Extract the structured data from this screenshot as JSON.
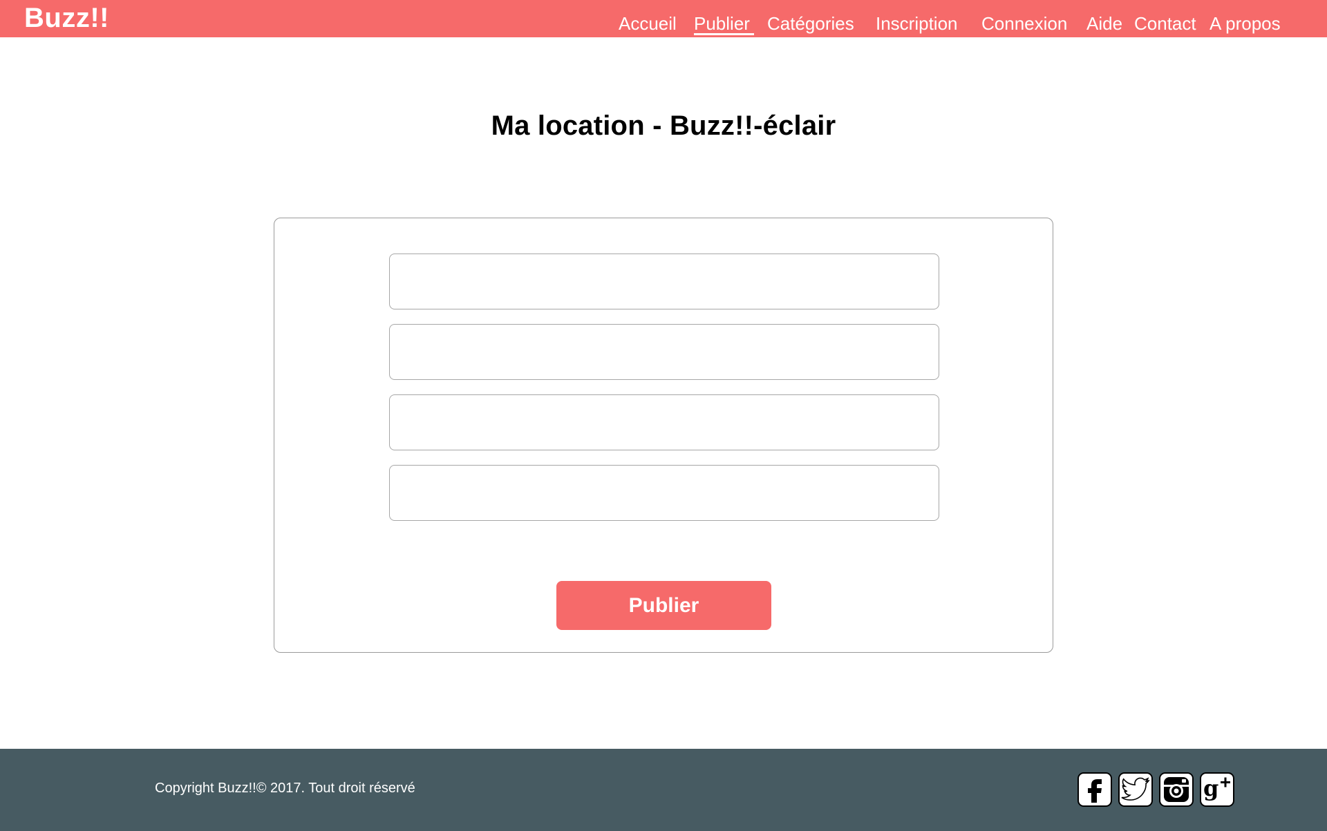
{
  "header": {
    "brand": "Buzz!!",
    "nav": [
      {
        "label": "Accueil",
        "active": false
      },
      {
        "label": "Publier",
        "active": true
      },
      {
        "label": "Catégories",
        "active": false
      },
      {
        "label": "Inscription",
        "active": false
      },
      {
        "label": "Connexion",
        "active": false
      },
      {
        "label": "Aide",
        "active": false
      },
      {
        "label": "Contact",
        "active": false
      },
      {
        "label": "A propos",
        "active": false
      }
    ]
  },
  "main": {
    "title": "Ma location - Buzz!!-éclair",
    "fields": [
      {
        "value": "",
        "placeholder": ""
      },
      {
        "value": "",
        "placeholder": ""
      },
      {
        "value": "",
        "placeholder": ""
      },
      {
        "value": "",
        "placeholder": ""
      }
    ],
    "submit_label": "Publier"
  },
  "footer": {
    "copyright": "Copyright Buzz!!© 2017. Tout droit réservé",
    "social": [
      {
        "icon": "facebook-icon"
      },
      {
        "icon": "twitter-icon"
      },
      {
        "icon": "instagram-icon"
      },
      {
        "icon": "google-plus-icon"
      }
    ]
  },
  "colors": {
    "brand": "#f66a6a",
    "footer": "#475b62",
    "card_border": "#9a9a9a"
  }
}
